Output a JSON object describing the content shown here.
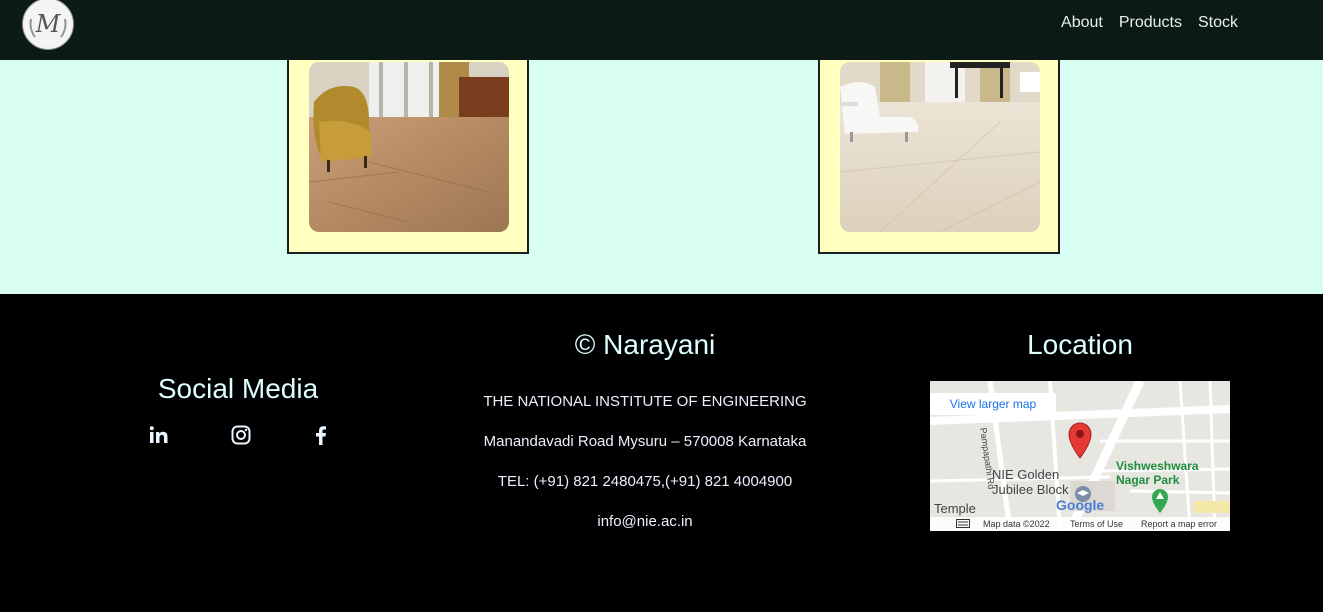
{
  "nav": {
    "links": [
      "About",
      "Products",
      "Stock"
    ],
    "logo_letter": "M"
  },
  "footer": {
    "social_title": "Social Media",
    "social_icons": [
      "linkedin-icon",
      "instagram-icon",
      "facebook-icon"
    ],
    "brand_title": "© Narayani",
    "institute": "THE NATIONAL INSTITUTE OF ENGINEERING",
    "address": "Manandavadi Road Mysuru – 570008 Karnataka",
    "tel": "TEL: (+91) 821 2480475,(+91) 821 4004900",
    "email": "info@nie.ac.in",
    "location_title": "Location"
  },
  "map": {
    "view_larger": "View larger map",
    "park_label": "Vishweshwara Nagar Park",
    "block_label": "NIE Golden Jubilee Block",
    "temple_label": "Temple",
    "road_label": "Pampapathi Rd",
    "map_data": "Map data ©2022",
    "terms": "Terms of Use",
    "report": "Report a map error",
    "google": "Google"
  },
  "colors": {
    "navbar": "#0b1a14",
    "product_bg": "#d8fdf3",
    "card_bg": "#ffffc0",
    "footer_bg": "#000000",
    "pin": "#e53935"
  }
}
